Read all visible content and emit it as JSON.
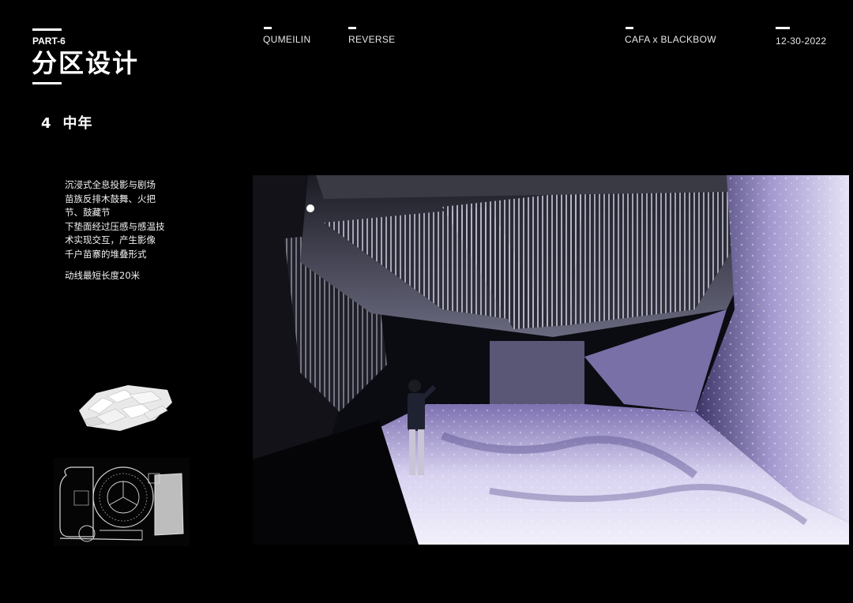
{
  "header": {
    "part": "PART-6",
    "title": "分区设计",
    "project": "QUMEILIN",
    "subtitle": "REVERSE",
    "collab": "CAFA x BLACKBOW",
    "date": "12-30-2022"
  },
  "section": {
    "number": "4",
    "name": "中年"
  },
  "description": {
    "lines": [
      "沉浸式全息投影与剧场",
      "苗族反排木鼓舞、火把",
      "节、鼓藏节",
      "下垫面经过压感与感温技",
      "术实现交互，产生影像",
      "千户苗寨的堆叠形式"
    ],
    "note": "动线最短长度20米"
  },
  "colors": {
    "background": "#000000",
    "text": "#ffffff",
    "projection_accent": "#8a7fc0"
  }
}
